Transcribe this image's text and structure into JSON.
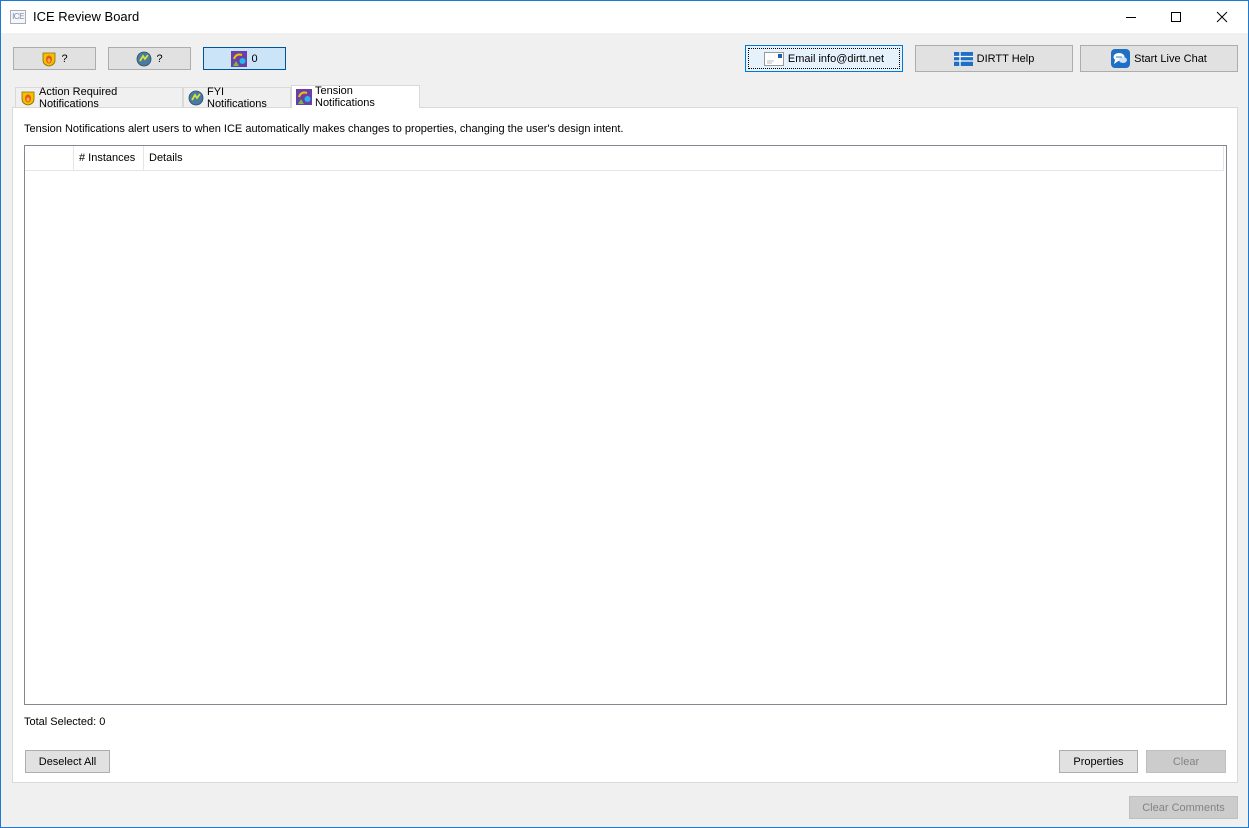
{
  "window": {
    "title": "ICE Review Board",
    "app_icon_text": "ICE",
    "controls": {
      "minimize": "minimize",
      "maximize": "maximize",
      "close": "close"
    }
  },
  "toolbar": {
    "filter_buttons": [
      {
        "icon": "shield-flame-icon",
        "count": "?",
        "selected": false
      },
      {
        "icon": "fyi-globe-icon",
        "count": "?",
        "selected": false
      },
      {
        "icon": "tension-shapes-icon",
        "count": "0",
        "selected": true
      }
    ],
    "email_label": "Email info@dirtt.net",
    "help_label": "DIRTT Help",
    "chat_label": "Start Live Chat"
  },
  "tabs": [
    {
      "label": "Action Required Notifications",
      "icon": "shield-flame-icon",
      "active": false
    },
    {
      "label": "FYI Notifications",
      "icon": "fyi-globe-icon",
      "active": false
    },
    {
      "label": "Tension Notifications",
      "icon": "tension-shapes-icon",
      "active": true
    }
  ],
  "panel": {
    "description": "Tension Notifications alert users to when ICE automatically makes changes to properties, changing the user's design intent.",
    "table": {
      "columns": [
        "",
        "# Instances",
        "Details"
      ],
      "rows": []
    },
    "total_selected": "Total Selected: 0",
    "deselect_all_label": "Deselect All",
    "properties_label": "Properties",
    "clear_label": "Clear"
  },
  "footer": {
    "clear_comments_label": "Clear Comments"
  },
  "colors": {
    "accent_border": "#1c7ad4",
    "selected_button": "#cce4f7",
    "disabled_text": "#838383"
  }
}
